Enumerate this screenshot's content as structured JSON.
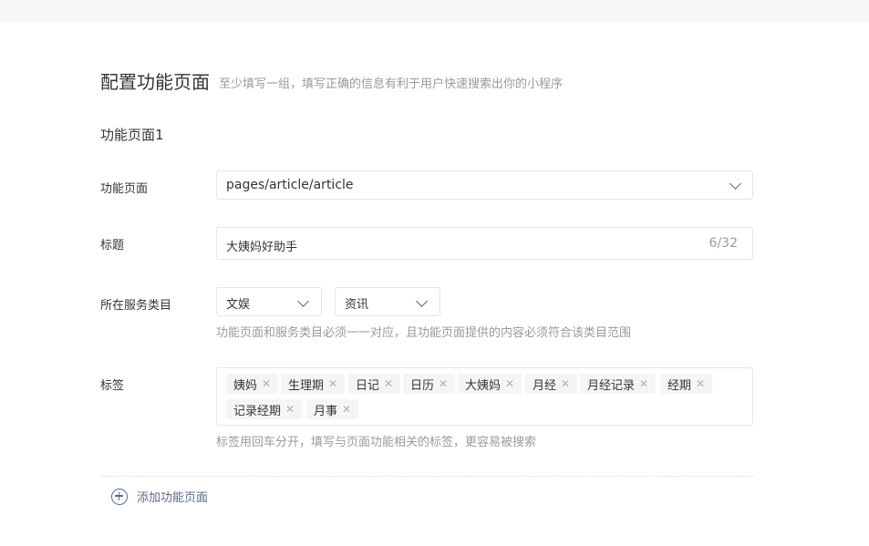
{
  "header": {
    "title": "配置功能页面",
    "subtitle": "至少填写一组，填写正确的信息有利于用户快速搜索出你的小程序"
  },
  "group": {
    "title": "功能页面1",
    "page_label": "功能页面",
    "page_value": "pages/article/article",
    "title_label": "标题",
    "title_value": "大姨妈好助手",
    "title_count": "6/32",
    "category_label": "所在服务类目",
    "category_primary": "文娱",
    "category_secondary": "资讯",
    "category_hint": "功能页面和服务类目必须一一对应，且功能页面提供的内容必须符合该类目范围",
    "tags_label": "标签",
    "tags": [
      "姨妈",
      "生理期",
      "日记",
      "日历",
      "大姨妈",
      "月经",
      "月经记录",
      "经期",
      "记录经期",
      "月事"
    ],
    "tags_hint": "标签用回车分开，填写与页面功能相关的标签，更容易被搜索"
  },
  "actions": {
    "add_page_label": "添加功能页面"
  },
  "icons": {
    "dropdown": "chevron-down-icon",
    "remove_tag": "close-icon",
    "add": "plus-circle-icon"
  },
  "colors": {
    "accent": "#5a6b86",
    "border": "#e4e6e9",
    "hint": "#9a9a9a"
  }
}
